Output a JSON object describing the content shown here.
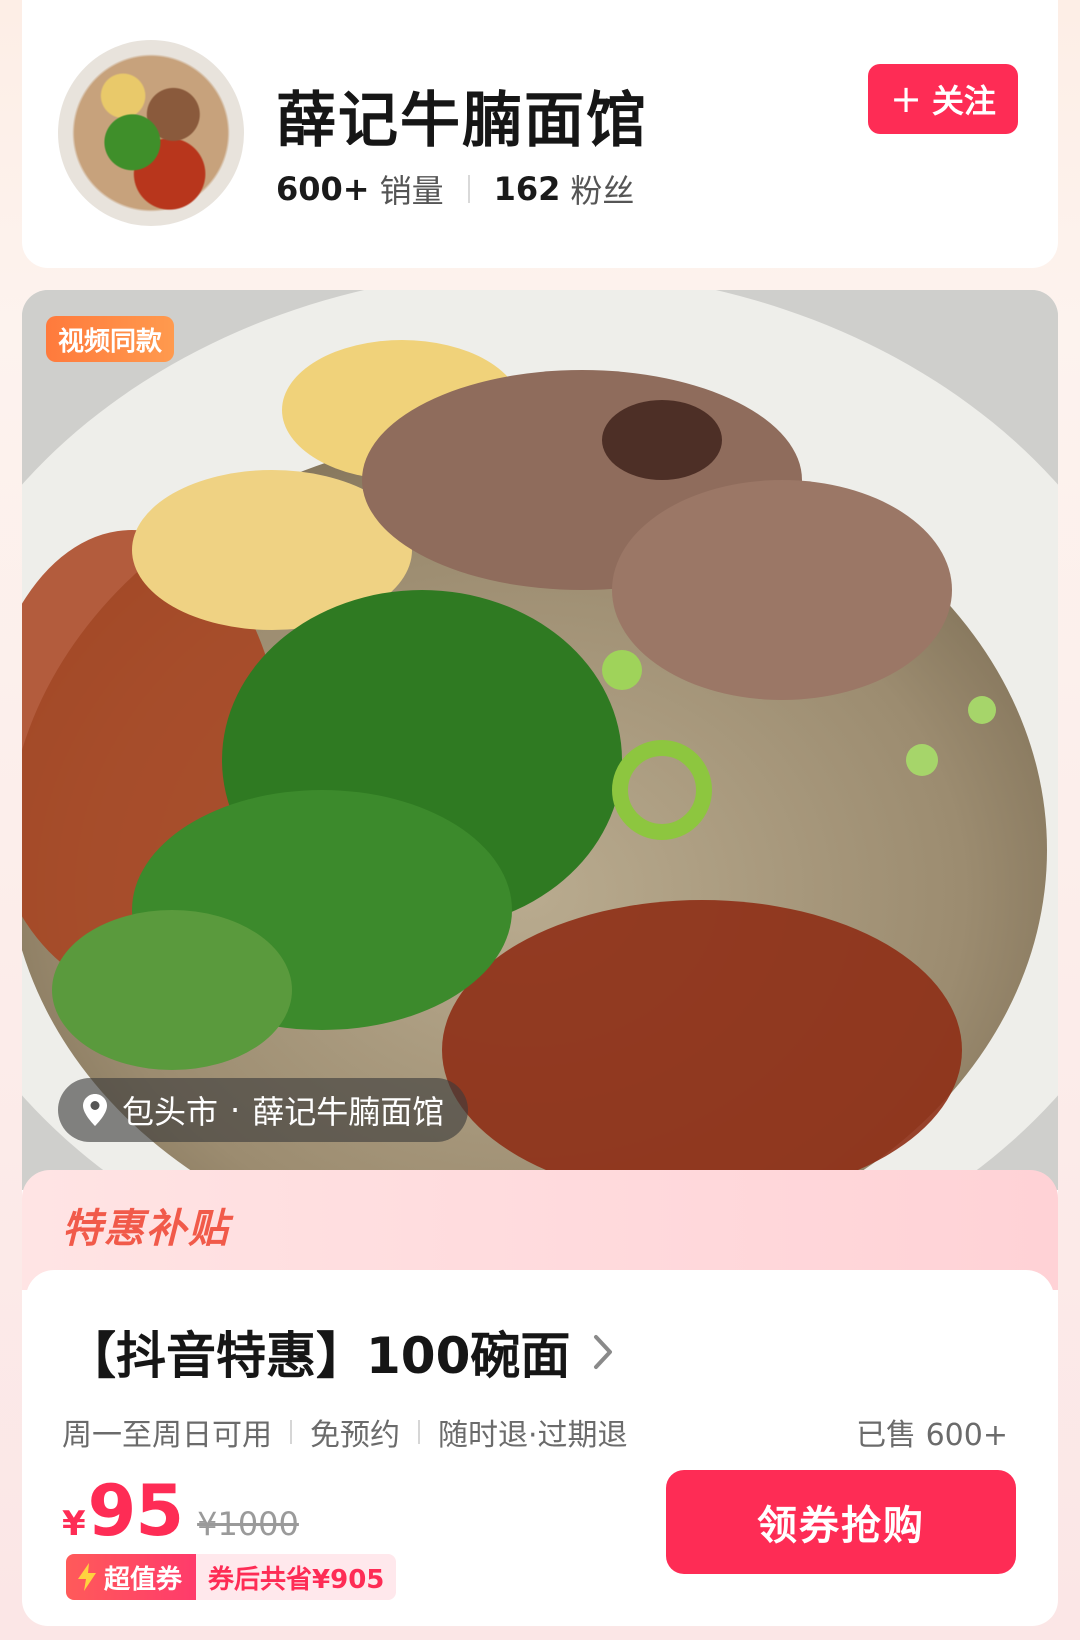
{
  "shop": {
    "name": "薛记牛腩面馆",
    "sales_num": "600+",
    "sales_label": "销量",
    "fans_num": "162",
    "fans_label": "粉丝",
    "follow_plus": "+",
    "follow_label": "关注"
  },
  "product": {
    "badge": "视频同款",
    "location_city": "包头市",
    "location_dot": "·",
    "location_shop": "薛记牛腩面馆"
  },
  "deal": {
    "section_title": "特惠补贴",
    "title": "【抖音特惠】100碗面",
    "meta": [
      "周一至周日可用",
      "免预约",
      "随时退·过期退"
    ],
    "sold": "已售 600+",
    "currency": "¥",
    "price": "95",
    "original_price": "¥1000",
    "coupon_label": "超值券",
    "coupon_saving": "券后共省¥905",
    "buy_label": "领券抢购"
  },
  "colors": {
    "accent": "#fe2c55",
    "subsidy_title": "#f15a4a",
    "badge": "#ff7a3c"
  },
  "icons": [
    "location-pin-icon",
    "chevron-right-icon",
    "lightning-icon",
    "plus-icon"
  ]
}
